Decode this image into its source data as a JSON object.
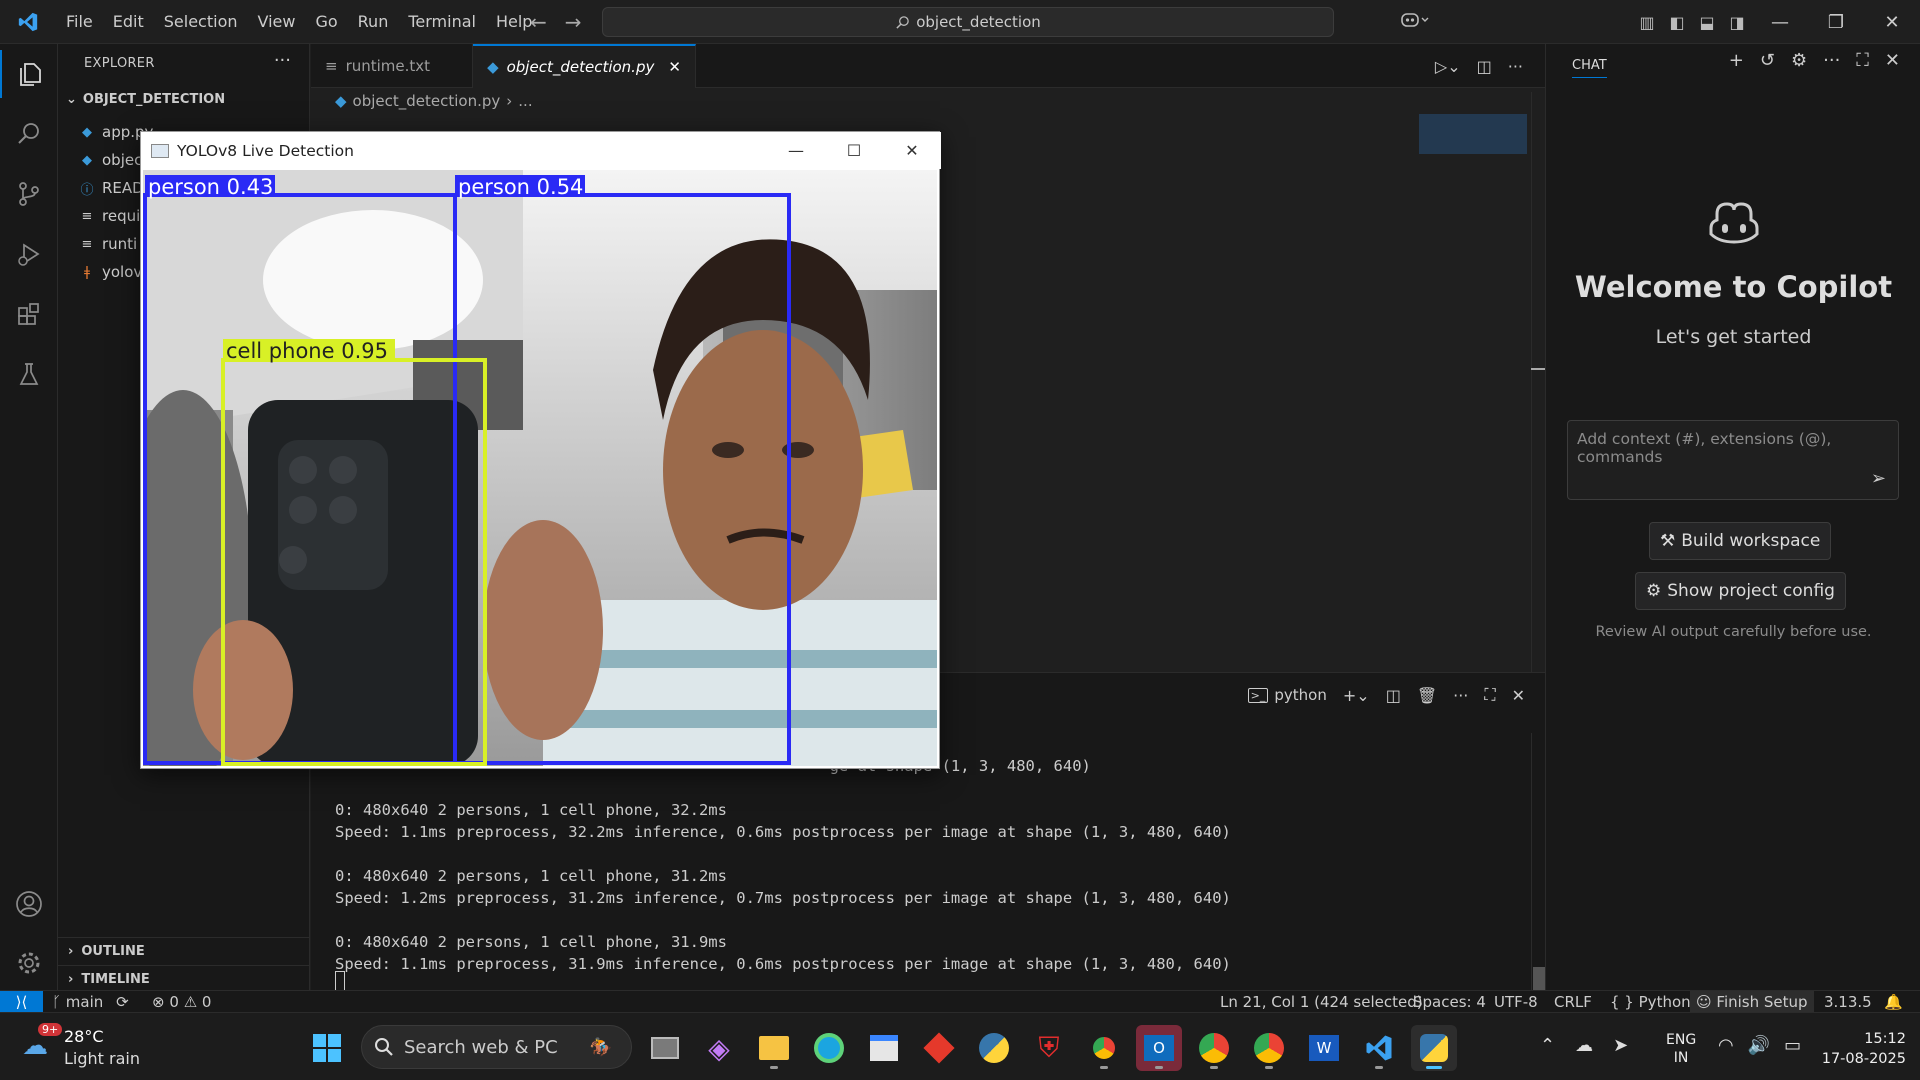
{
  "window": {
    "search_text": "object_detection",
    "menu": [
      "File",
      "Edit",
      "Selection",
      "View",
      "Go",
      "Run",
      "Terminal",
      "Help"
    ]
  },
  "explorer": {
    "title": "EXPLORER",
    "folder": "OBJECT_DETECTION",
    "files": [
      {
        "name": "app.py",
        "icon": "python-icon",
        "color": "#3b9ad9"
      },
      {
        "name": "objec",
        "icon": "python-icon",
        "color": "#3b9ad9"
      },
      {
        "name": "READ",
        "icon": "info-icon",
        "color": "#3b9ad9"
      },
      {
        "name": "requi",
        "icon": "text-lines-icon",
        "color": "#ccc"
      },
      {
        "name": "runti",
        "icon": "text-lines-icon",
        "color": "#ccc"
      },
      {
        "name": "yolov",
        "icon": "rss-icon",
        "color": "#e37933"
      }
    ],
    "outline": "OUTLINE",
    "timeline": "TIMELINE"
  },
  "editor": {
    "tabs": [
      {
        "label": "runtime.txt",
        "icon": "text-lines-icon",
        "active": false
      },
      {
        "label": "object_detection.py",
        "icon": "python-icon",
        "active": true
      }
    ],
    "breadcrumb_file": "object_detection.py",
    "breadcrumb_rest": "..."
  },
  "yolo_window": {
    "title": "YOLOv8 Live Detection",
    "detections": [
      {
        "label": "person 0.43",
        "color": "#2a2af5"
      },
      {
        "label": "person 0.54",
        "color": "#2a2af5"
      },
      {
        "label": "cell phone 0.95",
        "color": "#d8f026"
      }
    ]
  },
  "terminal": {
    "shell": "python",
    "lines": [
      "                                                     ge at shape (1, 3, 480, 640)",
      "",
      "0: 480x640 2 persons, 1 cell phone, 32.2ms",
      "Speed: 1.1ms preprocess, 32.2ms inference, 0.6ms postprocess per image at shape (1, 3, 480, 640)",
      "",
      "0: 480x640 2 persons, 1 cell phone, 31.2ms",
      "Speed: 1.2ms preprocess, 31.2ms inference, 0.7ms postprocess per image at shape (1, 3, 480, 640)",
      "",
      "0: 480x640 2 persons, 1 cell phone, 31.9ms",
      "Speed: 1.1ms preprocess, 31.9ms inference, 0.6ms postprocess per image at shape (1, 3, 480, 640)"
    ]
  },
  "chat": {
    "tab": "CHAT",
    "welcome": "Welcome to Copilot",
    "subtitle": "Let's get started",
    "input_placeholder": "Add context (#), extensions (@), commands",
    "build_button": "Build workspace",
    "config_button": "Show project config",
    "disclaimer": "Review AI output carefully before use."
  },
  "statusbar": {
    "branch": "main",
    "errors": "0",
    "warnings": "0",
    "position": "Ln 21, Col 1 (424 selected)",
    "spaces": "Spaces: 4",
    "encoding": "UTF-8",
    "eol": "CRLF",
    "language": "Python",
    "finish_setup": "Finish Setup",
    "version": "3.13.5"
  },
  "taskbar": {
    "weather_badge": "9+",
    "temperature": "28°C",
    "condition": "Light rain",
    "search_placeholder": "Search web & PC",
    "lang_top": "ENG",
    "lang_bottom": "IN",
    "time": "15:12",
    "date": "17-08-2025"
  },
  "colors": {
    "accent": "#0078d4",
    "box_person": "#2a2af5",
    "box_phone": "#d8f026"
  }
}
